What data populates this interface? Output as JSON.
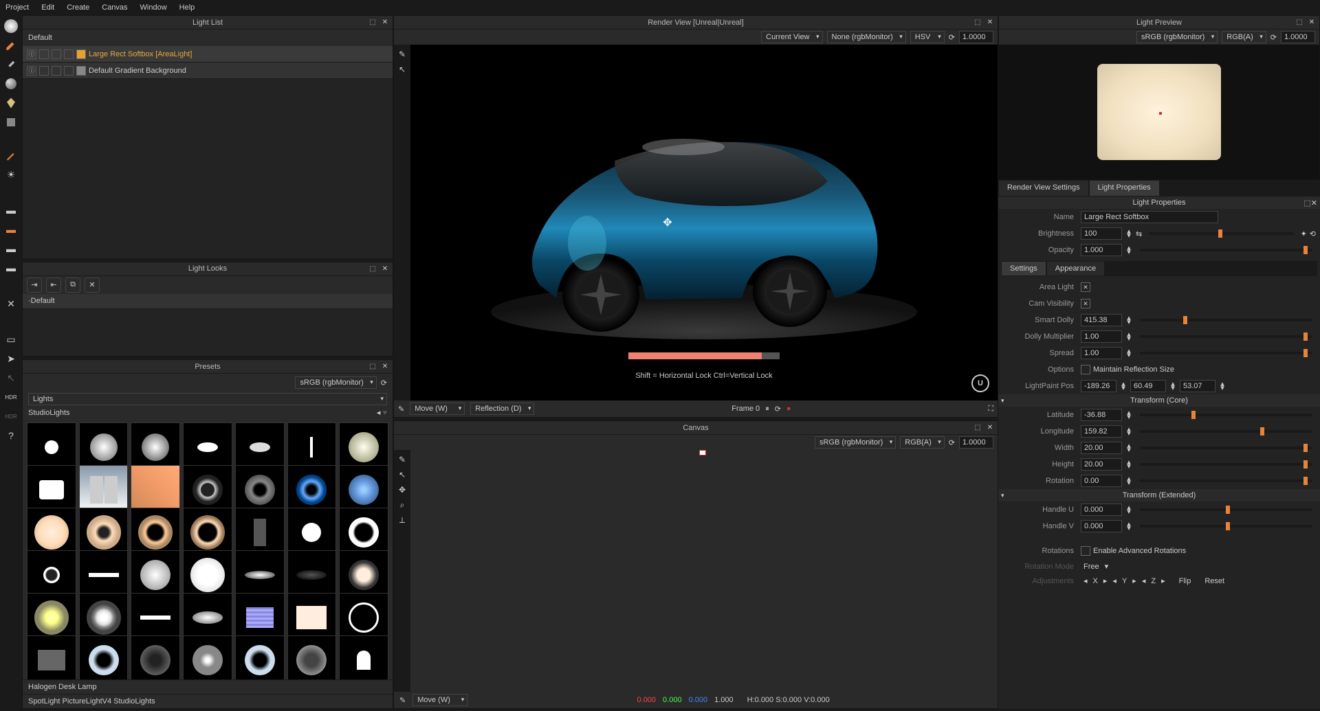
{
  "menu": [
    "Project",
    "Edit",
    "Create",
    "Canvas",
    "Window",
    "Help"
  ],
  "panels": {
    "lightList": {
      "title": "Light List",
      "default": "Default",
      "items": [
        {
          "name": "Large Rect Softbox [AreaLight]",
          "color": "#e8a030",
          "selected": true
        },
        {
          "name": "Default Gradient Background",
          "color": "#888",
          "selected": false
        }
      ]
    },
    "lightLooks": {
      "title": "Light Looks",
      "item": "Default"
    },
    "presets": {
      "title": "Presets",
      "colorspace": "sRGB (rgbMonitor)",
      "category": "Lights",
      "sub": "StudioLights",
      "hover": "Halogen Desk Lamp",
      "path": "SpotLight PictureLightV4 StudioLights"
    },
    "renderView": {
      "title": "Render View [Unreal|Unreal]",
      "currentView": "Current View",
      "monitor": "None (rgbMonitor)",
      "space": "HSV",
      "value": "1.0000",
      "hint": "Shift = Horizontal Lock   Ctrl=Vertical Lock"
    },
    "renderControls": {
      "tool": "Move (W)",
      "reflection": "Reflection (D)",
      "frame": "Frame 0"
    },
    "canvas": {
      "title": "Canvas",
      "monitor": "sRGB (rgbMonitor)",
      "channels": "RGB(A)",
      "value": "1.0000",
      "tool": "Move (W)",
      "rgba": [
        "0.000",
        "0.000",
        "0.000",
        "1.000"
      ],
      "hsv": "H:0.000 S:0.000 V:0.000"
    },
    "lightPreview": {
      "title": "Light Preview",
      "monitor": "sRGB (rgbMonitor)",
      "channels": "RGB(A)",
      "value": "1.0000"
    }
  },
  "tabs": {
    "left": "Render View Settings",
    "right": "Light Properties"
  },
  "properties": {
    "title": "Light Properties",
    "name": {
      "label": "Name",
      "value": "Large Rect Softbox"
    },
    "brightness": {
      "label": "Brightness",
      "value": "100"
    },
    "opacity": {
      "label": "Opacity",
      "value": "1.000"
    },
    "settingsTabs": [
      "Settings",
      "Appearance"
    ],
    "areaLight": {
      "label": "Area Light",
      "checked": true
    },
    "camVis": {
      "label": "Cam Visibility",
      "checked": true
    },
    "smartDolly": {
      "label": "Smart Dolly",
      "value": "415.38"
    },
    "dollyMult": {
      "label": "Dolly Multiplier",
      "value": "1.00"
    },
    "spread": {
      "label": "Spread",
      "value": "1.00"
    },
    "options": {
      "label": "Options",
      "text": "Maintain Reflection Size"
    },
    "lightPaint": {
      "label": "LightPaint Pos",
      "x": "-189.26",
      "y": "60.49",
      "z": "53.07"
    },
    "transformCore": "Transform (Core)",
    "latitude": {
      "label": "Latitude",
      "value": "-36.88"
    },
    "longitude": {
      "label": "Longitude",
      "value": "159.82"
    },
    "width": {
      "label": "Width",
      "value": "20.00"
    },
    "height": {
      "label": "Height",
      "value": "20.00"
    },
    "rotation": {
      "label": "Rotation",
      "value": "0.00"
    },
    "transformExt": "Transform (Extended)",
    "handleU": {
      "label": "Handle U",
      "value": "0.000"
    },
    "handleV": {
      "label": "Handle V",
      "value": "0.000"
    },
    "rotations": {
      "label": "Rotations",
      "text": "Enable Advanced Rotations"
    },
    "rotMode": {
      "label": "Rotation Mode",
      "value": "Free"
    },
    "adjustments": {
      "label": "Adjustments",
      "axes": [
        "X",
        "Y",
        "Z"
      ],
      "flip": "Flip",
      "reset": "Reset"
    }
  }
}
